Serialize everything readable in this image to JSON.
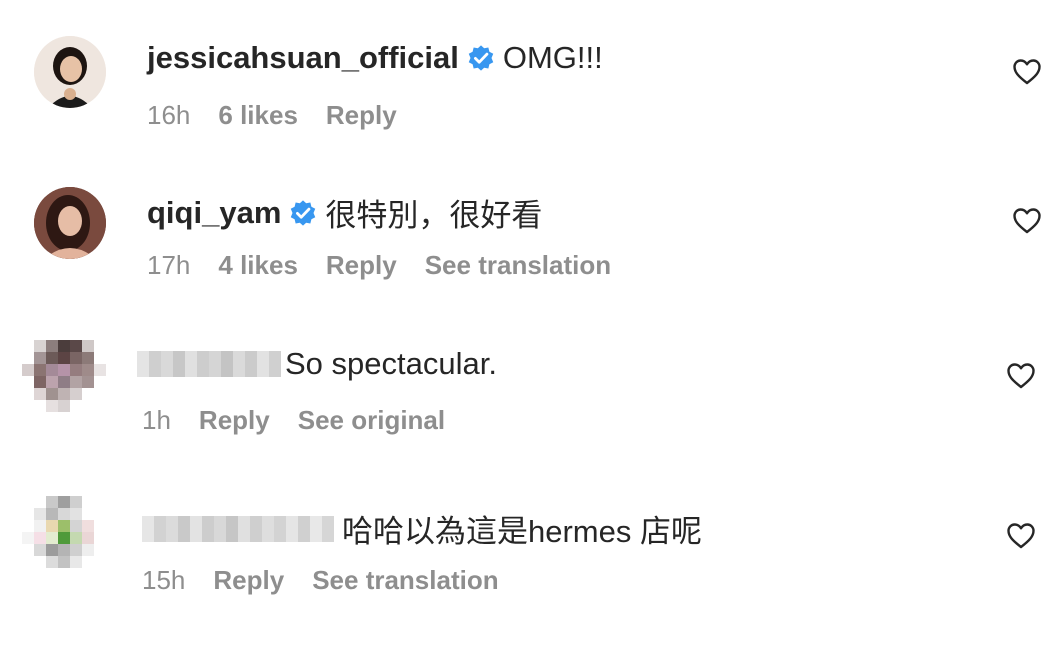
{
  "comments": [
    {
      "username": "jessicahsuan_official",
      "verified": true,
      "text": "OMG!!!",
      "time": "16h",
      "likes": "6 likes",
      "reply": "Reply",
      "extra": "",
      "avatar_icon": "profile-photo-woman-dark-hair",
      "heart_icon": "heart-outline-icon"
    },
    {
      "username": "qiqi_yam",
      "verified": true,
      "text": "很特別，很好看",
      "time": "17h",
      "likes": "4 likes",
      "reply": "Reply",
      "extra": "See translation",
      "avatar_icon": "profile-photo-woman-long-hair",
      "heart_icon": "heart-outline-icon"
    },
    {
      "username": "",
      "verified": false,
      "text": "So spectacular.",
      "time": "1h",
      "likes": "",
      "reply": "Reply",
      "extra": "See original",
      "avatar_icon": "pixelated-avatar",
      "heart_icon": "heart-outline-icon"
    },
    {
      "username": "",
      "verified": false,
      "text": "哈哈以為這是hermes 店呢",
      "time": "15h",
      "likes": "",
      "reply": "Reply",
      "extra": "See translation",
      "avatar_icon": "pixelated-avatar",
      "heart_icon": "heart-outline-icon"
    }
  ],
  "colors": {
    "text": "#262626",
    "meta": "#8e8e8e",
    "verified_blue": "#3897f0"
  }
}
